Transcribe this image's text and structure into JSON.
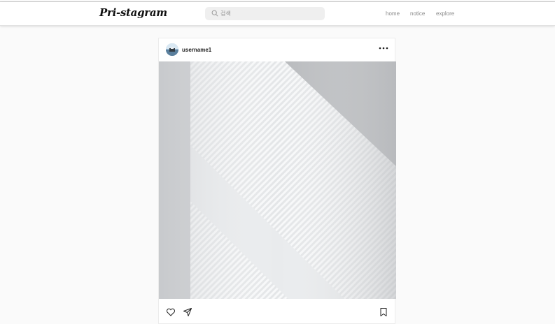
{
  "header": {
    "logo": "Pri-stagram",
    "search": {
      "placeholder": "검색",
      "icon": "search-icon"
    },
    "nav": {
      "home": "home",
      "notice": "notice",
      "explore": "explore"
    }
  },
  "post": {
    "username": "username1",
    "avatar_icon": "avatar",
    "more_icon": "more-dots-icon",
    "image_alt": "sunlight-shadow-on-wall",
    "actions": {
      "like_icon": "heart-icon",
      "share_icon": "send-icon",
      "save_icon": "bookmark-icon"
    }
  },
  "colors": {
    "background": "#fafafa",
    "header_bg": "#ffffff",
    "search_bg": "#efefef",
    "nav_text": "#8a8a8a"
  }
}
